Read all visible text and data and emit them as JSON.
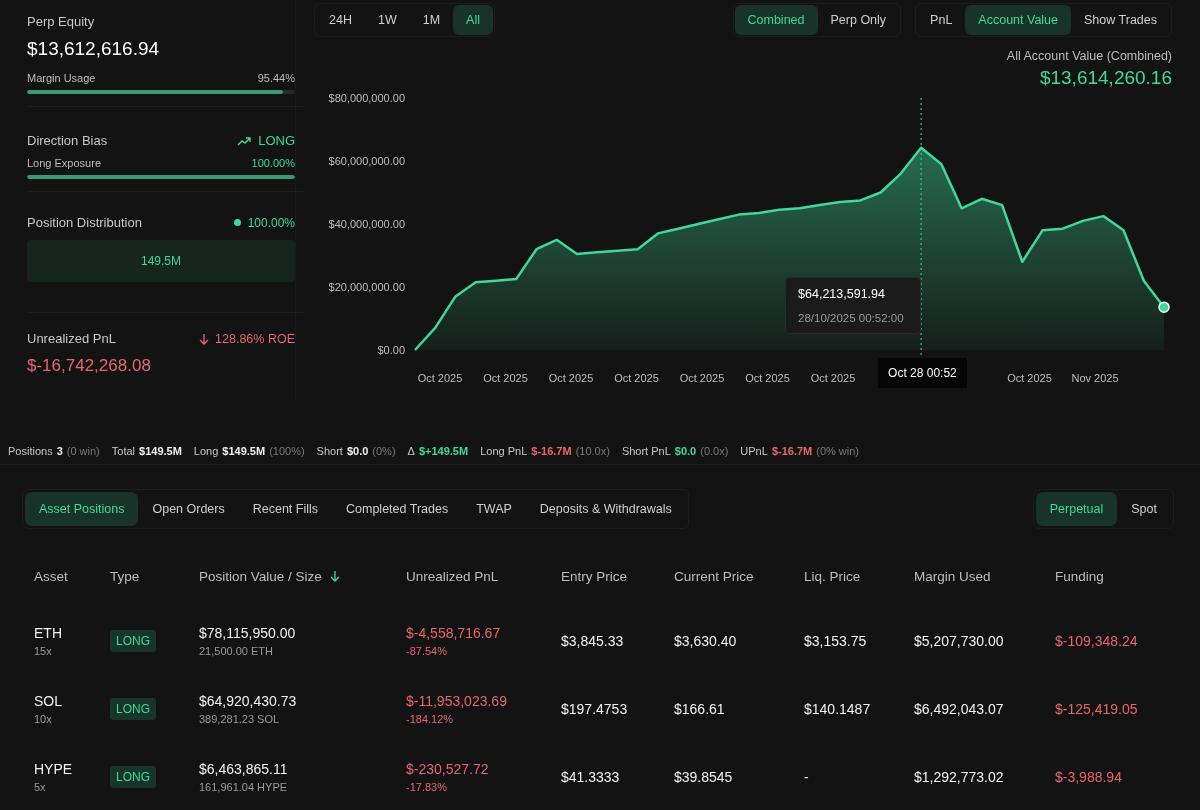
{
  "summary": {
    "equity_label": "Perp Equity",
    "equity": "$13,612,616.94",
    "margin_usage": {
      "label": "Margin Usage",
      "reading": "95.44%",
      "level": 0.9544
    },
    "direction_bias": {
      "label": "Direction Bias",
      "value": "LONG",
      "bearish": false
    },
    "long_exposure": {
      "label": "Long Exposure",
      "reading": "100.00%",
      "level": 1.0
    },
    "distribution": {
      "label": "Position Distribution",
      "reading": "100.00%",
      "color": "#3fd99a",
      "segments": [
        {
          "label": "149.5M",
          "level": 1.0
        }
      ]
    },
    "unrealized_pnl": {
      "label": "Unrealized PnL",
      "roe": "128.86% ROE",
      "value": "$-16,742,268.08",
      "negative": true
    }
  },
  "chart_panel": {
    "toggle_groups": [
      [
        {
          "label": "24H",
          "selected": false
        },
        {
          "label": "1W",
          "selected": false
        },
        {
          "label": "1M",
          "selected": false
        },
        {
          "label": "All",
          "selected": true
        }
      ],
      [
        {
          "label": "Combined",
          "selected": true
        },
        {
          "label": "Perp Only",
          "selected": false
        }
      ],
      [
        {
          "label": "PnL",
          "selected": false
        },
        {
          "label": "Account Value",
          "selected": true
        },
        {
          "label": "Show Trades",
          "selected": false
        }
      ]
    ],
    "heading": "All Account Value (Combined)",
    "current_value": "$13,614,260.16",
    "tooltip": {
      "value": "$64,213,591.94",
      "time": "28/10/2025 00:52:00"
    },
    "cursor_label": "Oct 28 00:52",
    "x_axis_labels": [
      "Oct 2025",
      "Oct 2025",
      "Oct 2025",
      "Oct 2025",
      "Oct 2025",
      "Oct 2025",
      "Oct 2025",
      "Oct 2025",
      "Nov 2025"
    ],
    "chart_data": {
      "type": "area",
      "ylim": [
        0,
        80000000
      ],
      "yticks": [
        {
          "value": 0,
          "label": "$0.00"
        },
        {
          "value": 20000000,
          "label": "$20,000,000.00"
        },
        {
          "value": 40000000,
          "label": "$40,000,000.00"
        },
        {
          "value": 60000000,
          "label": "$60,000,000.00"
        },
        {
          "value": 80000000,
          "label": "$80,000,000.00"
        }
      ],
      "series": [
        {
          "color": "#3fd99a",
          "values": [
            0,
            7000000,
            17000000,
            21500000,
            22000000,
            22500000,
            32000000,
            35000000,
            30500000,
            31000000,
            31500000,
            32000000,
            37000000,
            38500000,
            40000000,
            41500000,
            43000000,
            43500000,
            44500000,
            45000000,
            46000000,
            47000000,
            47500000,
            50000000,
            56000000,
            64200000,
            59000000,
            45000000,
            48000000,
            46000000,
            28000000,
            38000000,
            38500000,
            41000000,
            42500000,
            38000000,
            22000000,
            13600000
          ]
        }
      ]
    }
  },
  "stats": [
    {
      "label": "Positions",
      "value": "3",
      "note": "(0 win)",
      "color": "#f0f0f0"
    },
    {
      "label": "Total",
      "value": "$149.5M",
      "color": "#f0f0f0"
    },
    {
      "label": "Long",
      "value": "$149.5M",
      "note": "(100%)",
      "color": "#f0f0f0"
    },
    {
      "label": "Short",
      "value": "$0.0",
      "note": "(0%)",
      "color": "#f0f0f0"
    },
    {
      "label": "Δ",
      "value": "$+149.5M",
      "color": "#3fd99a"
    },
    {
      "label": "Long PnL",
      "value": "$-16.7M",
      "note": "(10.0x)",
      "color": "#e5676c"
    },
    {
      "label": "Short PnL",
      "value": "$0.0",
      "note": "(0.0x)",
      "color": "#3fd99a"
    },
    {
      "label": "UPnL",
      "value": "$-16.7M",
      "note": "(0% win)",
      "color": "#e5676c"
    }
  ],
  "tabs": [
    {
      "label": "Asset Positions",
      "selected": true
    },
    {
      "label": "Open Orders",
      "selected": false
    },
    {
      "label": "Recent Fills",
      "selected": false
    },
    {
      "label": "Completed Trades",
      "selected": false
    },
    {
      "label": "TWAP",
      "selected": false
    },
    {
      "label": "Deposits & Withdrawals",
      "selected": false
    }
  ],
  "market_tabs": [
    {
      "label": "Perpetual",
      "selected": true
    },
    {
      "label": "Spot",
      "selected": false
    }
  ],
  "table": {
    "columns": [
      {
        "label": "Asset",
        "sorted": false
      },
      {
        "label": "Type",
        "sorted": false
      },
      {
        "label": "Position Value / Size",
        "sorted": true
      },
      {
        "label": "Unrealized PnL",
        "sorted": false
      },
      {
        "label": "Entry Price",
        "sorted": false
      },
      {
        "label": "Current Price",
        "sorted": false
      },
      {
        "label": "Liq. Price",
        "sorted": false
      },
      {
        "label": "Margin Used",
        "sorted": false
      },
      {
        "label": "Funding",
        "sorted": false
      }
    ],
    "rows": [
      {
        "asset": "ETH",
        "leverage": "15x",
        "type": "LONG",
        "short": false,
        "value": "$78,115,950.00",
        "size": "21,500.00 ETH",
        "pnl": "$-4,558,716.67",
        "pnl_pct": "-87.54%",
        "pnl_negative": true,
        "entry": "$3,845.33",
        "current": "$3,630.40",
        "liq": "$3,153.75",
        "margin": "$5,207,730.00",
        "funding": "$-109,348.24",
        "funding_negative": true
      },
      {
        "asset": "SOL",
        "leverage": "10x",
        "type": "LONG",
        "short": false,
        "value": "$64,920,430.73",
        "size": "389,281.23 SOL",
        "pnl": "$-11,953,023.69",
        "pnl_pct": "-184.12%",
        "pnl_negative": true,
        "entry": "$197.4753",
        "current": "$166.61",
        "liq": "$140.1487",
        "margin": "$6,492,043.07",
        "funding": "$-125,419.05",
        "funding_negative": true
      },
      {
        "asset": "HYPE",
        "leverage": "5x",
        "type": "LONG",
        "short": false,
        "value": "$6,463,865.11",
        "size": "161,961.04 HYPE",
        "pnl": "$-230,527.72",
        "pnl_pct": "-17.83%",
        "pnl_negative": true,
        "entry": "$41.3333",
        "current": "$39.8545",
        "liq": "-",
        "margin": "$1,292,773.02",
        "funding": "$-3,988.94",
        "funding_negative": true
      }
    ]
  }
}
